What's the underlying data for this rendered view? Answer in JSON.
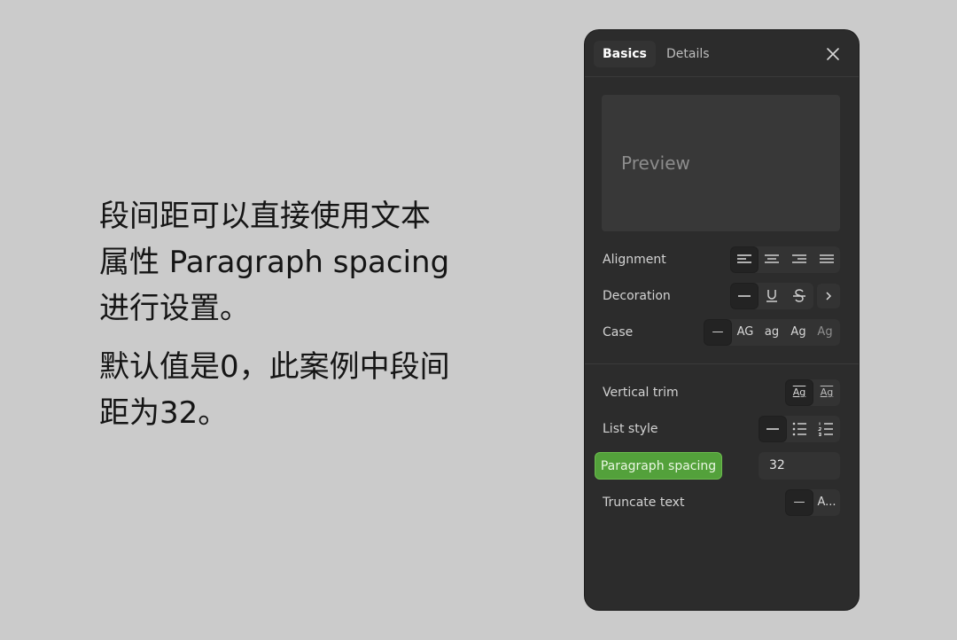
{
  "caption": {
    "paragraph1": "段间距可以直接使用文本\n属性 Paragraph spacing\n进行设置。",
    "paragraph2": "默认值是0，此案例中段间\n距为32。"
  },
  "panel": {
    "tabs": [
      {
        "label": "Basics",
        "active": true
      },
      {
        "label": "Details",
        "active": false
      }
    ],
    "close_icon": "close-icon",
    "preview_text": "Preview",
    "rows": {
      "alignment": {
        "label": "Alignment",
        "options": [
          "align-left-icon",
          "align-center-icon",
          "align-right-icon",
          "align-justify-icon"
        ],
        "selected": "align-left-icon"
      },
      "decoration": {
        "label": "Decoration",
        "options": [
          "none",
          "underline",
          "strikethrough"
        ],
        "selected": "none",
        "more_icon": "chevron-right-icon"
      },
      "case": {
        "label": "Case",
        "options": [
          "—",
          "AG",
          "ag",
          "Ag",
          "Ag"
        ],
        "selected": "—"
      },
      "vertical_trim": {
        "label": "Vertical trim",
        "options": [
          "Ag",
          "Ag"
        ],
        "selected_index": 0
      },
      "list_style": {
        "label": "List style",
        "options": [
          "none",
          "bulleted-list-icon",
          "numbered-list-icon"
        ],
        "selected": "none"
      },
      "paragraph_spacing": {
        "label": "Paragraph spacing",
        "value": "32"
      },
      "truncate_text": {
        "label": "Truncate text",
        "options": [
          "—",
          "A..."
        ],
        "selected": "—"
      }
    },
    "colors": {
      "panel_bg": "#2c2c2c",
      "highlight_green": "#53a13b",
      "page_bg": "#cbcbcb"
    }
  }
}
